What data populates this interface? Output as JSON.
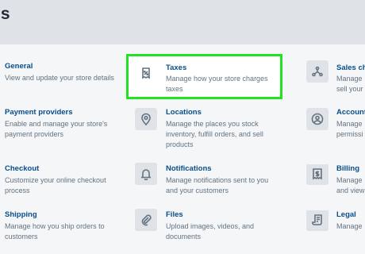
{
  "header": {
    "title": "gs"
  },
  "items": {
    "general": {
      "title": "General",
      "desc": "View and update your store details"
    },
    "taxes": {
      "title": "Taxes",
      "desc": "Manage how your store charges taxes"
    },
    "sales": {
      "title": "Sales ch",
      "desc": "Manage\nsell your"
    },
    "payment": {
      "title": "Payment providers",
      "desc": "Enable and manage your store's payment providers"
    },
    "locations": {
      "title": "Locations",
      "desc": "Manage the places you stock inventory, fulfill orders, and sell products"
    },
    "account": {
      "title": "Account",
      "desc": "Manage\npermissi"
    },
    "checkout": {
      "title": "Checkout",
      "desc": "Customize your online checkout process"
    },
    "notifications": {
      "title": "Notifications",
      "desc": "Manage notifications sent to you and your customers"
    },
    "billing": {
      "title": "Billing",
      "desc": "Manage\nand view"
    },
    "shipping": {
      "title": "Shipping",
      "desc": "Manage how you ship orders to customers"
    },
    "files": {
      "title": "Files",
      "desc": "Upload images, videos, and documents"
    },
    "legal": {
      "title": "Legal",
      "desc": "Manage"
    }
  },
  "colors": {
    "highlight": "#22e322",
    "link": "#084e8a",
    "header_bg": "#dfe3e8"
  }
}
